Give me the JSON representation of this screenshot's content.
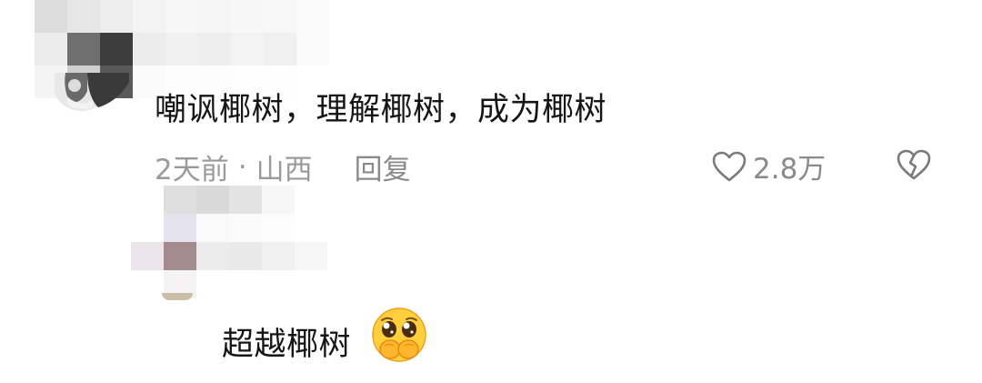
{
  "comments": [
    {
      "text": "嘲讽椰树，理解椰树，成为椰树",
      "time": "2天前",
      "separator": "·",
      "location": "山西",
      "reply_label": "回复",
      "like_count": "2.8万"
    },
    {
      "text": "超越椰树",
      "emoji": "pleading-face-hands-over-mouth"
    }
  ],
  "colors": {
    "text": "#161616",
    "meta": "#9a9a9a",
    "icon": "#7a7a7a",
    "emoji_yellow": "#ffcf3d"
  }
}
